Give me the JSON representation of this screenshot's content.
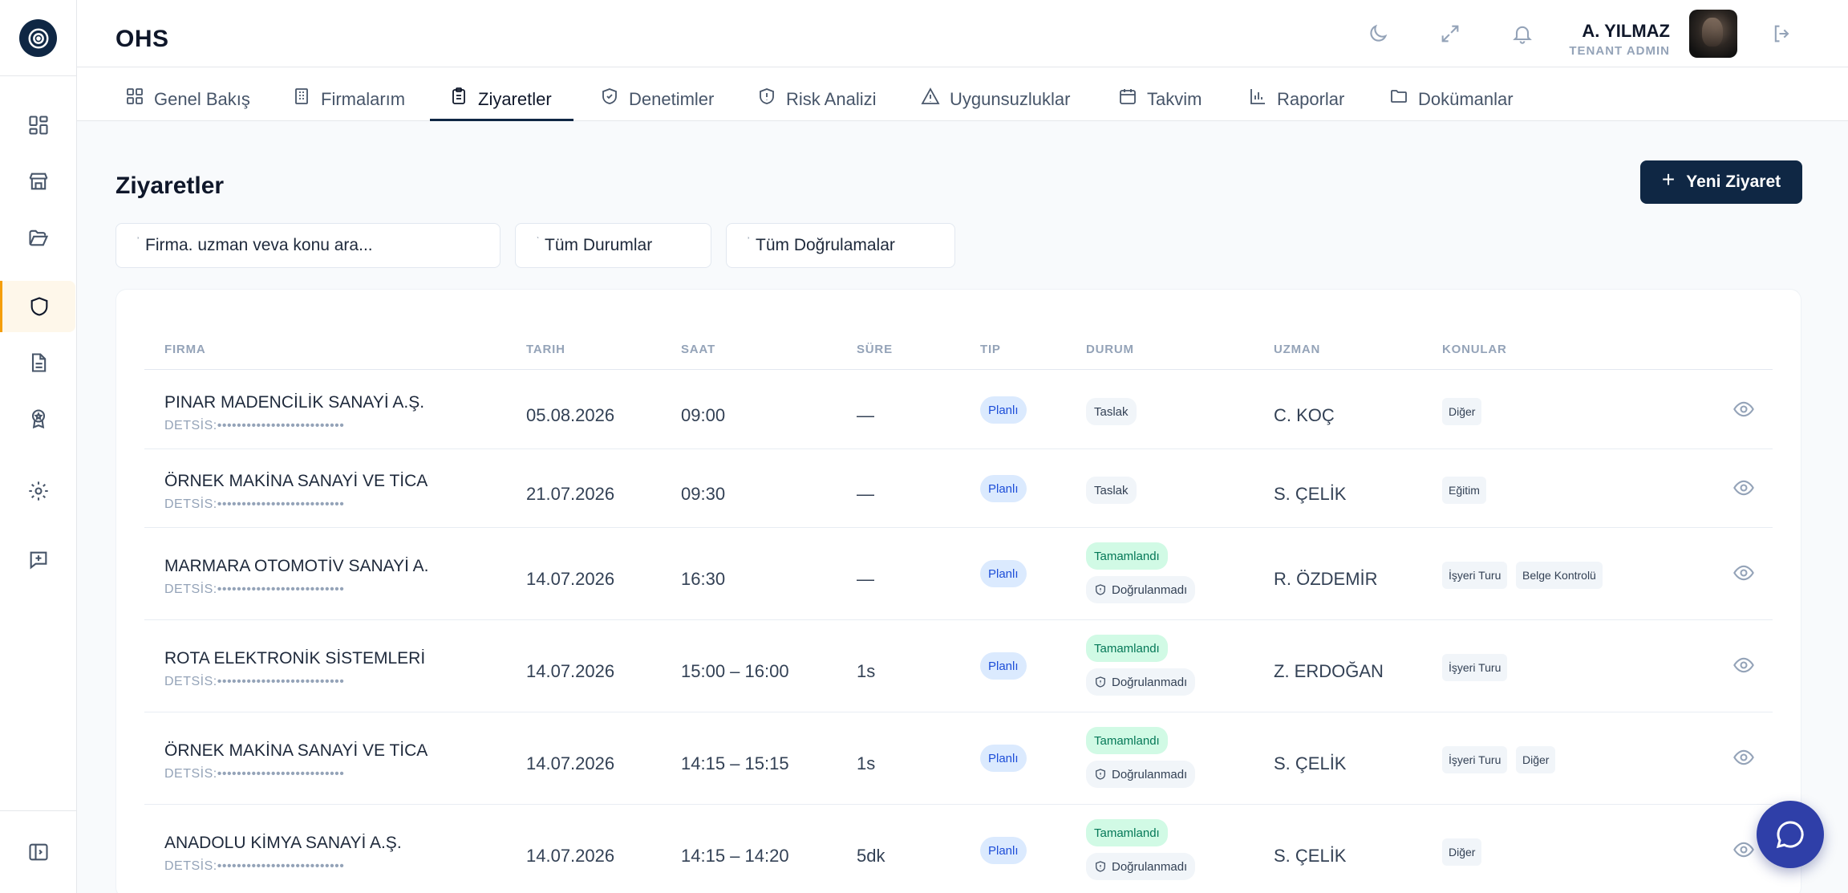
{
  "app": {
    "brand": "OHS"
  },
  "user": {
    "name": "A. YILMAZ",
    "role": "TENANT ADMIN"
  },
  "tabs": [
    {
      "label": "Genel Bakış",
      "icon": "dashboard-icon"
    },
    {
      "label": "Firmalarım",
      "icon": "building-icon"
    },
    {
      "label": "Ziyaretler",
      "icon": "clipboard-icon"
    },
    {
      "label": "Denetimler",
      "icon": "shield-check-icon"
    },
    {
      "label": "Risk Analizi",
      "icon": "shield-alert-icon"
    },
    {
      "label": "Uygunsuzluklar",
      "icon": "warning-icon"
    },
    {
      "label": "Takvim",
      "icon": "calendar-icon"
    },
    {
      "label": "Raporlar",
      "icon": "bar-chart-icon"
    },
    {
      "label": "Dokümanlar",
      "icon": "folder-icon"
    }
  ],
  "active_tab": "Ziyaretler",
  "page": {
    "title": "Ziyaretler",
    "new_button": "Yeni Ziyaret"
  },
  "filters": {
    "search_placeholder": "Firma. uzman veva konu ara...",
    "status": "Tüm Durumlar",
    "verification": "Tüm Doğrulamalar"
  },
  "table": {
    "headers": [
      "FIRMA",
      "TARIH",
      "SAAT",
      "SÜRE",
      "TIP",
      "DURUM",
      "UZMAN",
      "KONULAR"
    ],
    "rows": [
      {
        "firma": "PINAR MADENCİLİK SANAYİ A.Ş.",
        "detsis": "DETSİS:••••••••••••••••••••••••••",
        "tarih": "05.08.2026",
        "saat": "09:00",
        "sure": "—",
        "tip": "Planlı",
        "durum": "Taslak",
        "dogrulama": "",
        "uzman": "C. KOÇ",
        "konular": [
          "Diğer"
        ]
      },
      {
        "firma": "ÖRNEK MAKİNA SANAYİ VE TİCARET",
        "detsis": "DETSİS:••••••••••••••••••••••••••",
        "tarih": "21.07.2026",
        "saat": "09:30",
        "sure": "—",
        "tip": "Planlı",
        "durum": "Taslak",
        "dogrulama": "",
        "uzman": "S. ÇELİK",
        "konular": [
          "Eğitim"
        ]
      },
      {
        "firma": "MARMARA OTOMOTİV SANAYİ A.Ş.",
        "detsis": "DETSİS:••••••••••••••••••••••••••",
        "tarih": "14.07.2026",
        "saat": "16:30",
        "sure": "—",
        "tip": "Planlı",
        "durum": "Tamamlandı",
        "dogrulama": "Doğrulanmadı",
        "uzman": "R. ÖZDEMİR",
        "konular": [
          "İşyeri Turu",
          "Belge Kontrolü"
        ]
      },
      {
        "firma": "ROTA ELEKTRONİK SİSTEMLERİ LTD.",
        "detsis": "DETSİS:••••••••••••••••••••••••••",
        "tarih": "14.07.2026",
        "saat": "15:00 – 16:00",
        "sure": "1s",
        "tip": "Planlı",
        "durum": "Tamamlandı",
        "dogrulama": "Doğrulanmadı",
        "uzman": "Z. ERDOĞAN",
        "konular": [
          "İşyeri Turu"
        ]
      },
      {
        "firma": "ÖRNEK MAKİNA SANAYİ VE TİCARET",
        "detsis": "DETSİS:••••••••••••••••••••••••••",
        "tarih": "14.07.2026",
        "saat": "14:15 – 15:15",
        "sure": "1s",
        "tip": "Planlı",
        "durum": "Tamamlandı",
        "dogrulama": "Doğrulanmadı",
        "uzman": "S. ÇELİK",
        "konular": [
          "İşyeri Turu",
          "Diğer"
        ]
      },
      {
        "firma": "ANADOLU KİMYA SANAYİ A.Ş.",
        "detsis": "DETSİS:••••••••••••••••••••••••••",
        "tarih": "14.07.2026",
        "saat": "14:15 – 14:20",
        "sure": "5dk",
        "tip": "Planlı",
        "durum": "Tamamlandı",
        "dogrulama": "Doğrulanmadı",
        "uzman": "S. ÇELİK",
        "konular": [
          "Diğer"
        ]
      }
    ]
  },
  "rail": [
    "dashboard-icon",
    "store-icon",
    "folder-open-icon",
    "shield-icon",
    "document-icon",
    "award-icon",
    "settings-icon",
    "message-plus-icon",
    "sidebar-toggle-icon"
  ],
  "colors": {
    "primary": "#0f2744",
    "accent": "#f59e0b",
    "success": "#047857",
    "info": "#1d4ed8",
    "chat": "#2f3fa8"
  }
}
